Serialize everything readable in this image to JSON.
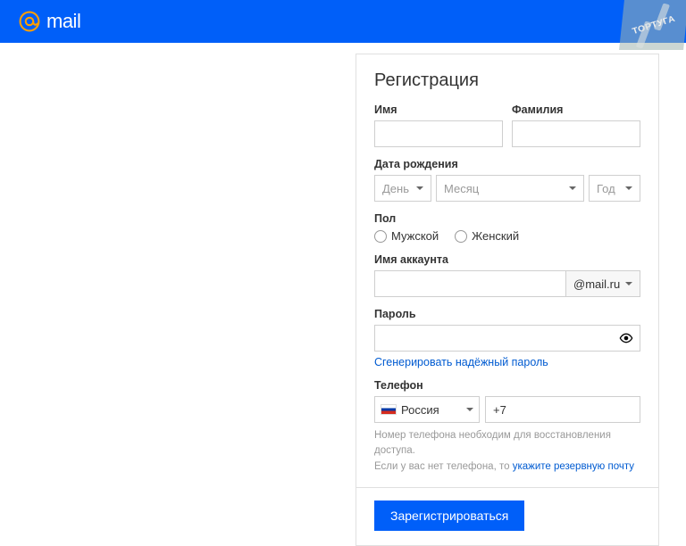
{
  "header": {
    "brand": "mail"
  },
  "watermark": "ТОРТУГА",
  "form": {
    "title": "Регистрация",
    "first_name_label": "Имя",
    "last_name_label": "Фамилия",
    "dob_label": "Дата рождения",
    "dob_day": "День",
    "dob_month": "Месяц",
    "dob_year": "Год",
    "gender_label": "Пол",
    "gender_male": "Мужской",
    "gender_female": "Женский",
    "account_label": "Имя аккаунта",
    "account_domain": "@mail.ru",
    "password_label": "Пароль",
    "generate_link": "Сгенерировать надёжный пароль",
    "phone_label": "Телефон",
    "phone_country": "Россия",
    "phone_prefix": "+7",
    "hint_1": "Номер телефона необходим для восстановления доступа.",
    "hint_2a": "Если у вас нет телефона, то ",
    "hint_2b": "укажите резервную почту",
    "submit": "Зарегистрироваться"
  }
}
